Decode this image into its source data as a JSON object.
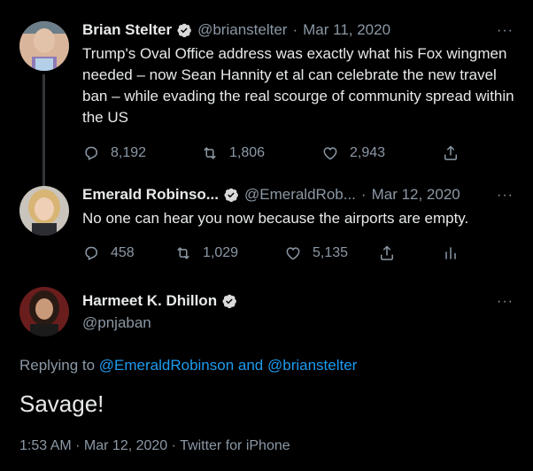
{
  "tweets": [
    {
      "name": "Brian Stelter",
      "handle": "@brianstelter",
      "separator": "·",
      "date": "Mar 11, 2020",
      "text": "Trump's Oval Office address was exactly what his Fox wingmen needed – now Sean Hannity et al can celebrate the new travel ban – while evading the real scourge of community spread within the US",
      "replies": "8,192",
      "retweets": "1,806",
      "likes": "2,943"
    },
    {
      "name": "Emerald Robinso...",
      "handle": "@EmeraldRob...",
      "separator": "·",
      "date": "Mar 12, 2020",
      "text": "No one can hear you now because the airports are empty.",
      "replies": "458",
      "retweets": "1,029",
      "likes": "5,135"
    }
  ],
  "main_tweet": {
    "name": "Harmeet K. Dhillon",
    "handle": "@pnjaban",
    "replying_prefix": "Replying to ",
    "replying_to": "@EmeraldRobinson and @brianstelter",
    "text": "Savage!",
    "meta": "1:53 AM · Mar 12, 2020 · Twitter for iPhone"
  },
  "more_label": "···",
  "colors": {
    "background": "#000000",
    "link": "#1d9bf0",
    "muted": "#8b98a5",
    "verified": "#d9d9d9"
  },
  "icons": [
    "verified-badge-icon",
    "reply-icon",
    "retweet-icon",
    "like-icon",
    "share-icon",
    "analytics-icon",
    "more-icon"
  ]
}
